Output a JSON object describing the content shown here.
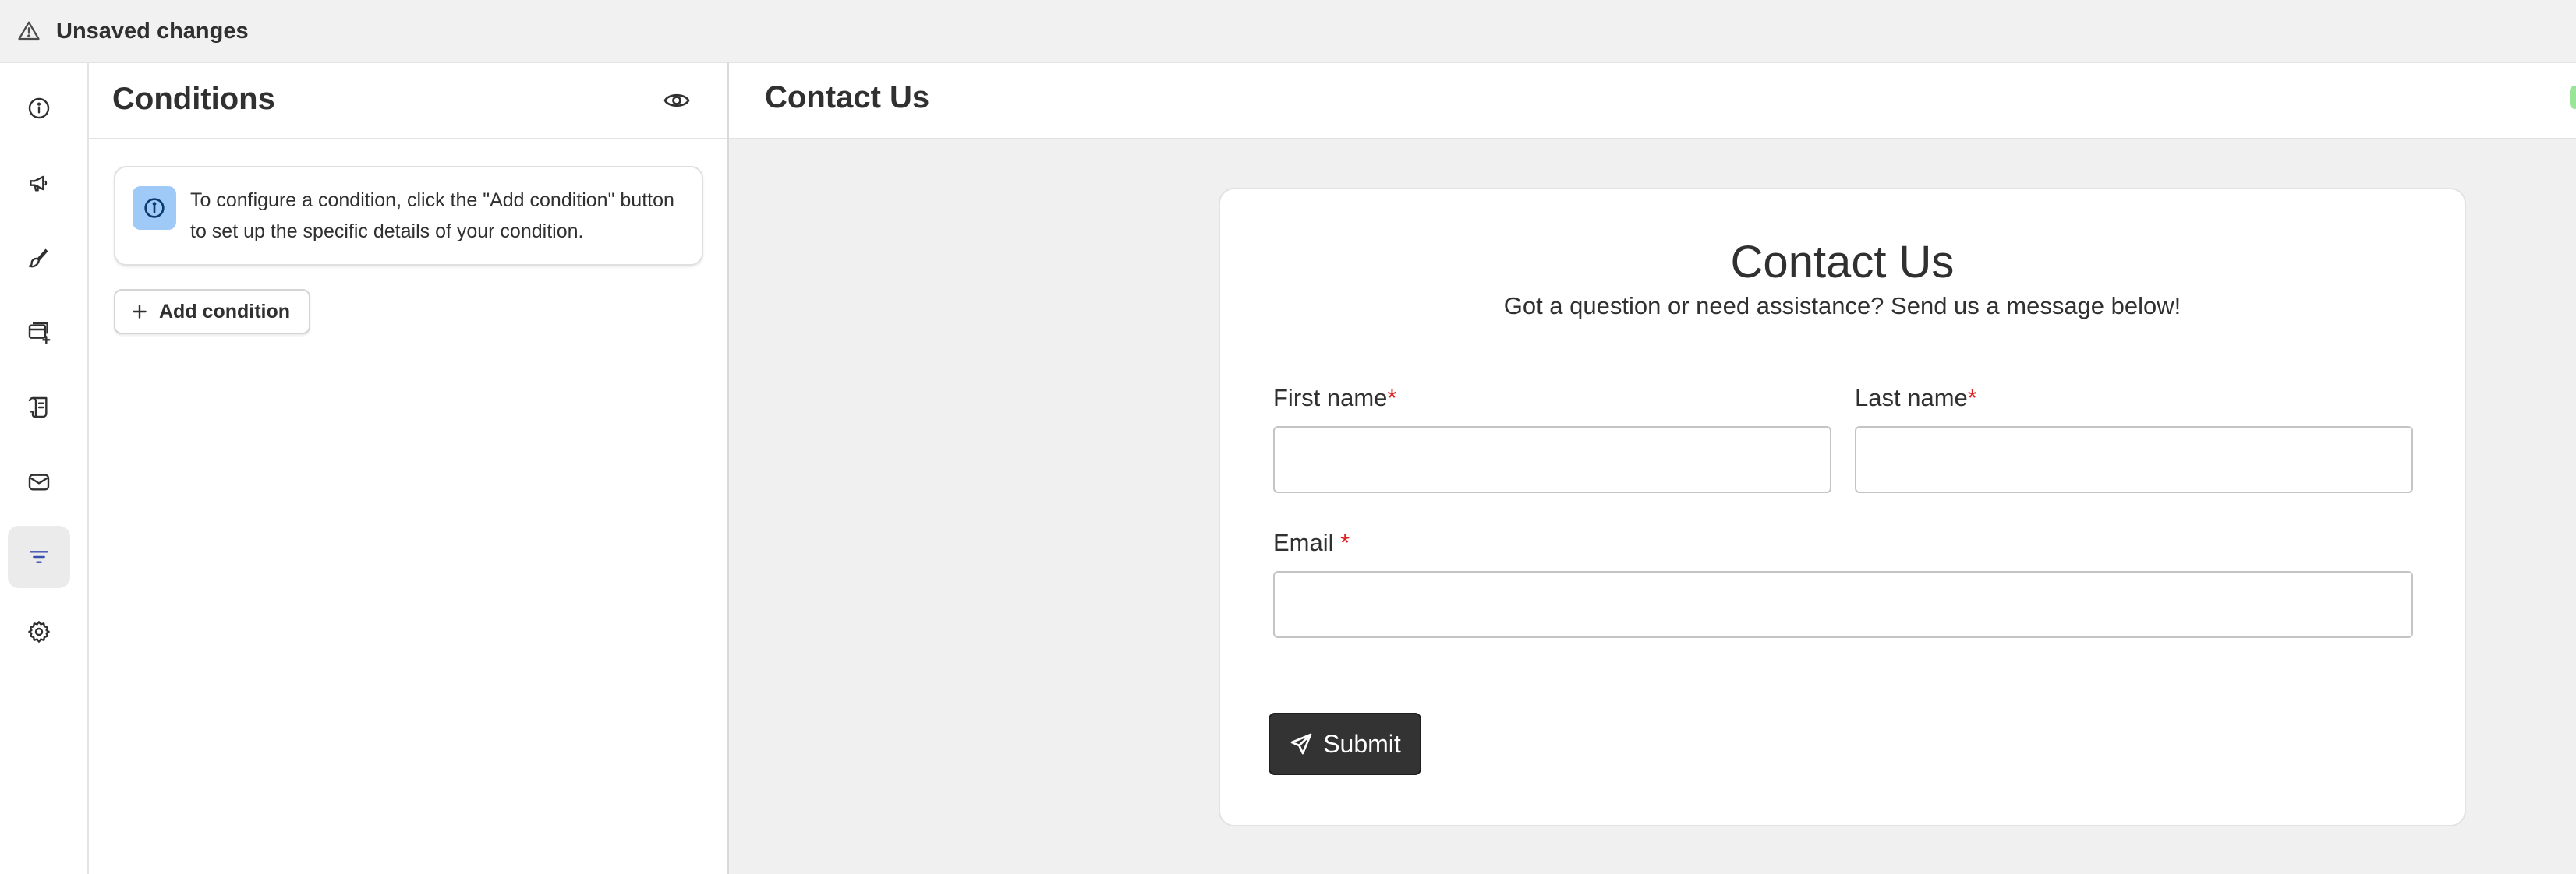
{
  "topbar": {
    "status": "Unsaved changes"
  },
  "rail": {
    "items": [
      {
        "name": "info",
        "active": false
      },
      {
        "name": "megaphone",
        "active": false
      },
      {
        "name": "brush",
        "active": false
      },
      {
        "name": "layout-add",
        "active": false
      },
      {
        "name": "receipt",
        "active": false
      },
      {
        "name": "mail",
        "active": false
      },
      {
        "name": "filter",
        "active": true
      },
      {
        "name": "settings",
        "active": false
      }
    ]
  },
  "conditions": {
    "title": "Conditions",
    "info_text": "To configure a condition, click the \"Add condition\" button to set up the specific details of your condition.",
    "add_label": "Add condition"
  },
  "preview": {
    "header_title": "Contact Us",
    "form": {
      "title": "Contact Us",
      "subtitle": "Got a question or need assistance? Send us a message below!",
      "first_name_label": "First name",
      "last_name_label": "Last name",
      "email_label": "Email ",
      "required_mark": "*",
      "submit_label": "Submit"
    }
  },
  "colors": {
    "active_icon": "#3a4fb0",
    "info_badge": "#9fcaf7",
    "required": "#e02020",
    "submit_bg": "#333333"
  }
}
